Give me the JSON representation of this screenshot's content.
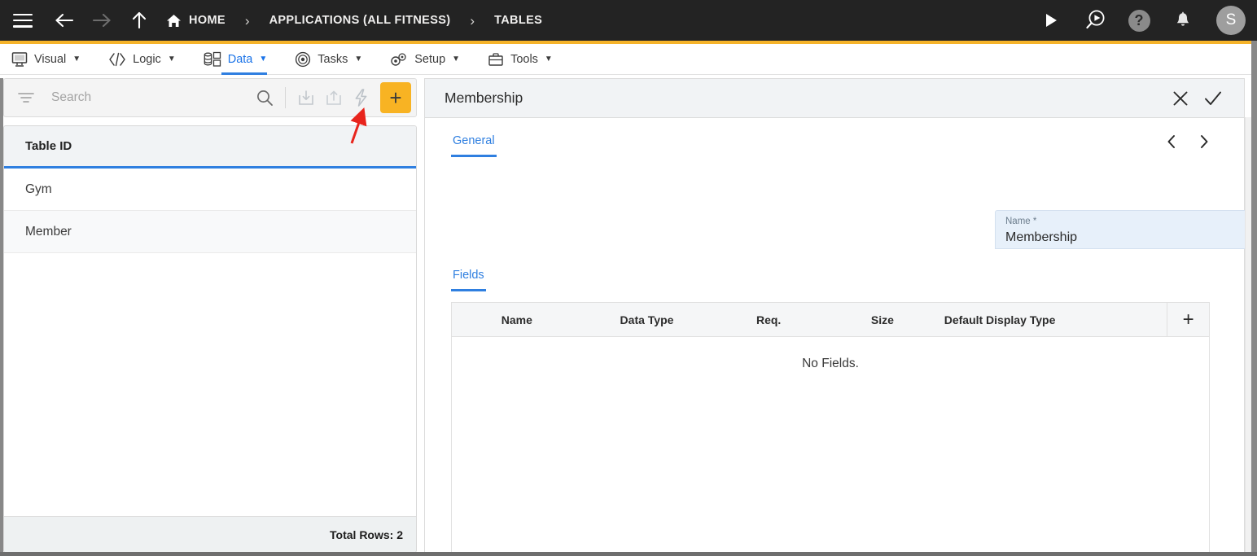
{
  "topbar": {
    "menu_icon": "hamburger-icon",
    "back_icon": "arrow-left-icon",
    "forward_icon": "arrow-right-icon",
    "up_icon": "arrow-up-icon",
    "breadcrumbs": [
      {
        "label": "HOME",
        "icon": "home-icon"
      },
      {
        "label": "APPLICATIONS (ALL FITNESS)",
        "icon": ""
      },
      {
        "label": "TABLES",
        "icon": ""
      }
    ],
    "separator": "›",
    "actions": [
      {
        "name": "run-icon",
        "label": ""
      },
      {
        "name": "search-preview-icon",
        "label": ""
      },
      {
        "name": "help-icon",
        "label": "?"
      },
      {
        "name": "notifications-bell-icon",
        "label": ""
      }
    ],
    "avatar_initial": "S",
    "background": "#232323",
    "accent_color": "#f5b32a"
  },
  "menubar": {
    "items": [
      {
        "label": "Visual",
        "icon": "monitor-icon",
        "caret": "▼",
        "active": false
      },
      {
        "label": "Logic",
        "icon": "code-brackets-icon",
        "caret": "▼",
        "active": false
      },
      {
        "label": "Data",
        "icon": "database-icon",
        "caret": "▼",
        "active": true
      },
      {
        "label": "Tasks",
        "icon": "target-icon",
        "caret": "▼",
        "active": false
      },
      {
        "label": "Setup",
        "icon": "gears-icon",
        "caret": "▼",
        "active": false
      },
      {
        "label": "Tools",
        "icon": "toolbox-icon",
        "caret": "▼",
        "active": false
      }
    ],
    "active_color": "#1a73e8"
  },
  "left_panel": {
    "toolbar": {
      "filter_icon": "filter-icon",
      "search_placeholder": "Search",
      "search_value": "",
      "search_icon": "magnifier-icon",
      "import_icon": "import-icon",
      "export_icon": "export-icon",
      "lightning_icon": "lightning-bolt-icon",
      "add_label": "+",
      "add_color": "#f8b323"
    },
    "table": {
      "column_header": "Table ID",
      "rows": [
        {
          "name": "Gym"
        },
        {
          "name": "Member"
        }
      ],
      "footer": "Total Rows: 2"
    }
  },
  "right_panel": {
    "title": "Membership",
    "close_label": "✕",
    "save_label": "✓",
    "tabs": [
      {
        "label": "General",
        "active": true
      }
    ],
    "pager": {
      "prev": "‹",
      "next": "›"
    },
    "name_field": {
      "label": "Name *",
      "value": "Membership",
      "background": "#e7f0fa"
    },
    "fields_section": {
      "tab_label": "Fields",
      "columns": [
        "Name",
        "Data Type",
        "Req.",
        "Size",
        "Default Display Type"
      ],
      "add_label": "+",
      "empty_message": "No Fields.",
      "rows": []
    }
  },
  "annotation": {
    "arrow_color": "#e8241c",
    "points_to": "lightning-bolt-icon"
  }
}
